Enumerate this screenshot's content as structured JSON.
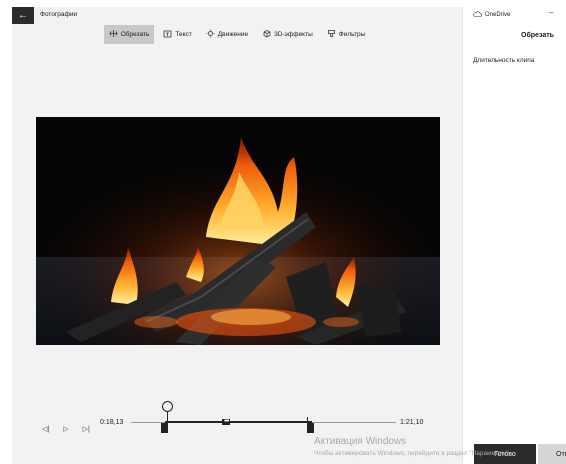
{
  "window": {
    "app_title": "Фотографии",
    "back_icon": "back-arrow-icon"
  },
  "toolbar": {
    "tools": [
      {
        "label": "Обрезать",
        "icon": "trim-icon",
        "active": true
      },
      {
        "label": "Текст",
        "icon": "text-icon",
        "active": false
      },
      {
        "label": "Движение",
        "icon": "motion-icon",
        "active": false
      },
      {
        "label": "3D-эффекты",
        "icon": "3d-effects-icon",
        "active": false
      },
      {
        "label": "Фильтры",
        "icon": "filters-icon",
        "active": false
      }
    ]
  },
  "timeline": {
    "start_time": "0:18,13",
    "end_time": "1:21,10",
    "selection_marker": "•••"
  },
  "panel": {
    "onedrive_label": "OneDrive",
    "minimize_symbol": "–",
    "title": "Обрезать",
    "clip_length_label": "Длительность клипа",
    "done_label": "Готово",
    "other_label": "Отм"
  },
  "watermark": {
    "line1": "Активация Windows",
    "line2": "Чтобы активировать Windows, перейдите в раздел \"Параметры\"."
  },
  "colors": {
    "editor_bg": "#f2f2f2",
    "dark_button": "#2b2b2b",
    "active_tool": "#c8c8c8"
  }
}
